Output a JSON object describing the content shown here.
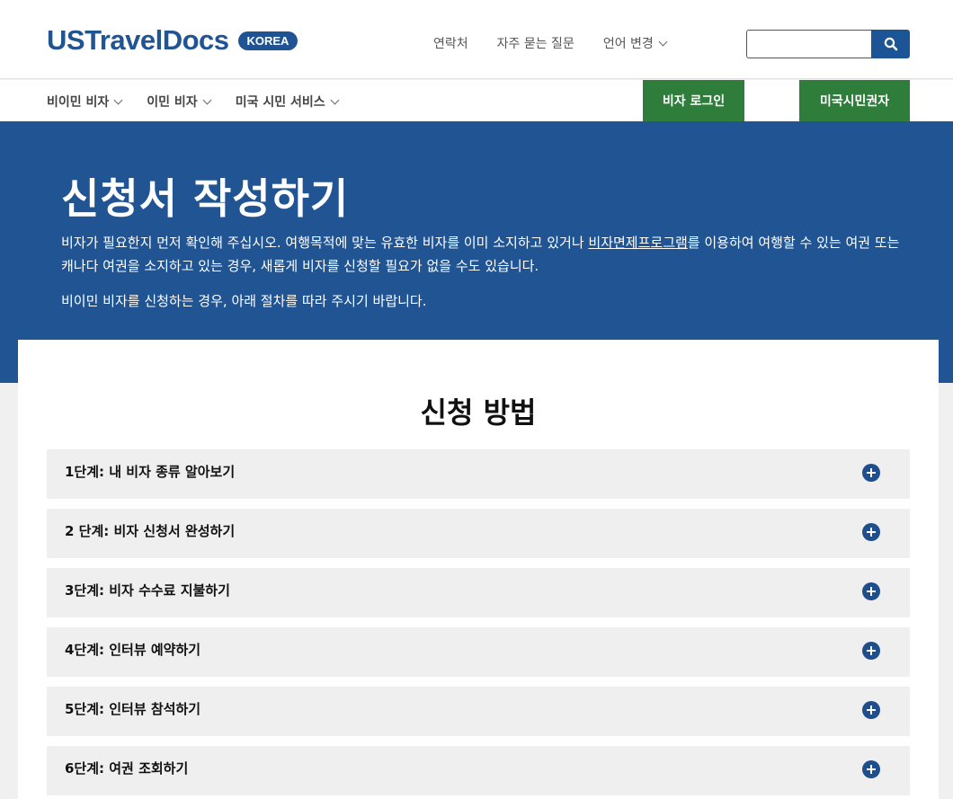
{
  "header": {
    "logo_text": "USTravelDocs",
    "logo_badge": "KOREA",
    "nav": [
      "연락처",
      "자주 묻는 질문",
      "언어 변경"
    ],
    "search": {
      "placeholder": ""
    }
  },
  "mainnav": {
    "items": [
      "비이민 비자",
      "이민 비자",
      "미국 시민 서비스"
    ],
    "visa_login": "비자 로그인",
    "citizen_services": "미국시민권자"
  },
  "hero": {
    "title": "신청서 작성하기",
    "p1_before": "비자가 필요한지 먼저 확인해 주십시오. 여행목적에 맞는 유효한 비자를 이미 소지하고 있거나 ",
    "p1_link": "비자면제프로그램",
    "p1_after": "를 이용하여 여행할 수 있는 여권 또는 캐나다 여권을 소지하고 있는 경우, 새롭게 비자를 신청할 필요가 없을 수도 있습니다.",
    "p2": "비이민 비자를 신청하는 경우, 아래 절차를 따라 주시기 바랍니다."
  },
  "section": {
    "title": "신청 방법",
    "steps": [
      "1단계: 내 비자 종류 알아보기",
      "2 단계: 비자 신청서 완성하기",
      "3단계: 비자 수수료 지불하기",
      "4단계: 인터뷰 예약하기",
      "5단계: 인터뷰 참석하기",
      "6단계: 여권 조회하기"
    ]
  },
  "colors": {
    "brand_blue": "#205493",
    "green": "#2e7d3a"
  }
}
